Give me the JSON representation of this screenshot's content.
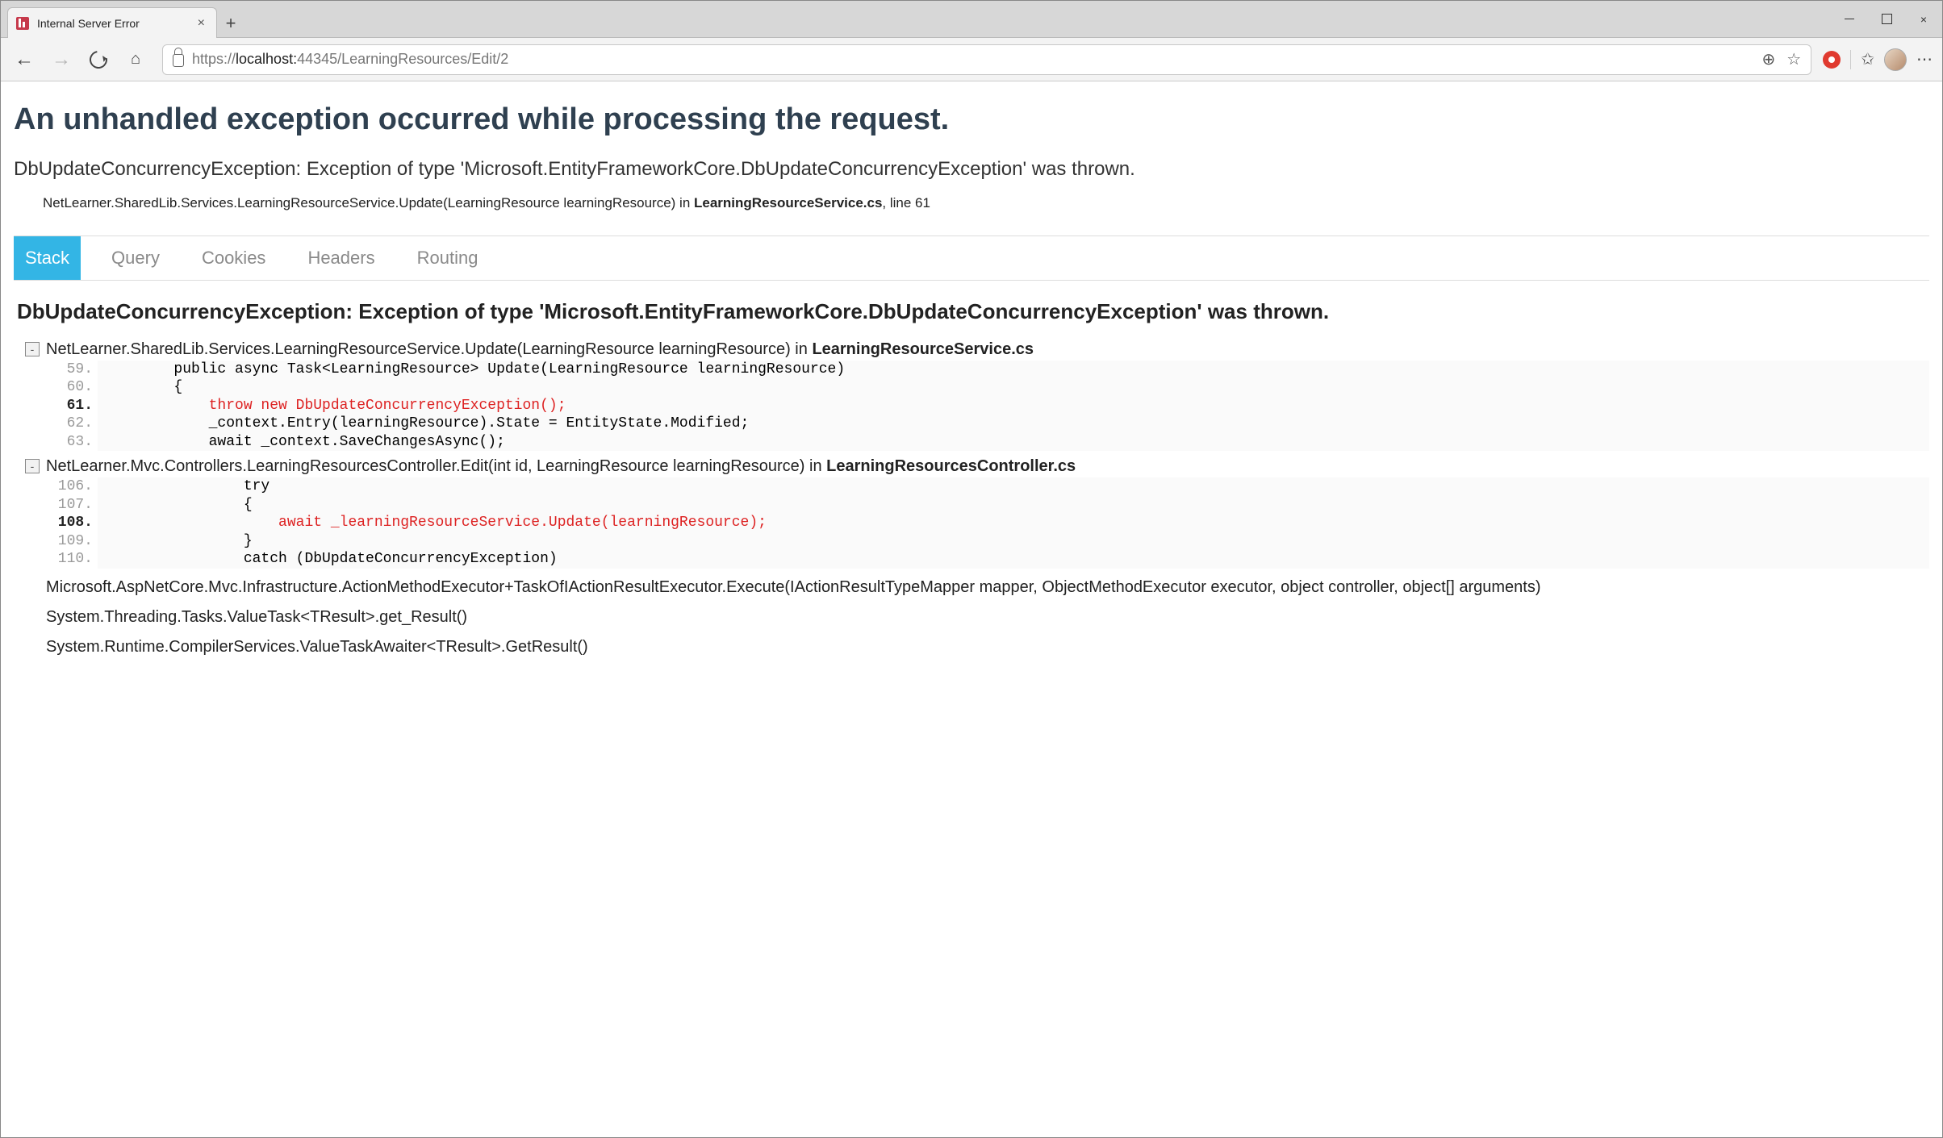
{
  "browser": {
    "tab_title": "Internal Server Error",
    "url_prefix": "https://",
    "url_host": "localhost:",
    "url_path": "44345/LearningResources/Edit/2"
  },
  "page": {
    "title": "An unhandled exception occurred while processing the request.",
    "subtitle": "DbUpdateConcurrencyException: Exception of type 'Microsoft.EntityFrameworkCore.DbUpdateConcurrencyException' was thrown.",
    "source_method": "NetLearner.SharedLib.Services.LearningResourceService.Update(LearningResource learningResource) in ",
    "source_file": "LearningResourceService.cs",
    "source_suffix": ", line 61"
  },
  "devtabs": {
    "stack": "Stack",
    "query": "Query",
    "cookies": "Cookies",
    "headers": "Headers",
    "routing": "Routing"
  },
  "exception_header": "DbUpdateConcurrencyException: Exception of type 'Microsoft.EntityFrameworkCore.DbUpdateConcurrencyException' was thrown.",
  "frame1": {
    "method": "NetLearner.SharedLib.Services.LearningResourceService.Update(LearningResource learningResource) in ",
    "file": "LearningResourceService.cs",
    "toggle": "-",
    "lines": {
      "n59": "59.",
      "c59": "        public async Task<LearningResource> Update(LearningResource learningResource)",
      "n60": "60.",
      "c60": "        {",
      "n61": "61.",
      "c61": "            throw new DbUpdateConcurrencyException();",
      "n62": "62.",
      "c62": "            _context.Entry(learningResource).State = EntityState.Modified;",
      "n63": "63.",
      "c63": "            await _context.SaveChangesAsync();"
    }
  },
  "frame2": {
    "method": "NetLearner.Mvc.Controllers.LearningResourcesController.Edit(int id, LearningResource learningResource) in ",
    "file": "LearningResourcesController.cs",
    "toggle": "-",
    "lines": {
      "n106": "106.",
      "c106": "                try",
      "n107": "107.",
      "c107": "                {",
      "n108": "108.",
      "c108": "                    await _learningResourceService.Update(learningResource);",
      "n109": "109.",
      "c109": "                }",
      "n110": "110.",
      "c110": "                catch (DbUpdateConcurrencyException)"
    }
  },
  "plain_frames": {
    "f1": "Microsoft.AspNetCore.Mvc.Infrastructure.ActionMethodExecutor+TaskOfIActionResultExecutor.Execute(IActionResultTypeMapper mapper, ObjectMethodExecutor executor, object controller, object[] arguments)",
    "f2": "System.Threading.Tasks.ValueTask<TResult>.get_Result()",
    "f3": "System.Runtime.CompilerServices.ValueTaskAwaiter<TResult>.GetResult()"
  }
}
